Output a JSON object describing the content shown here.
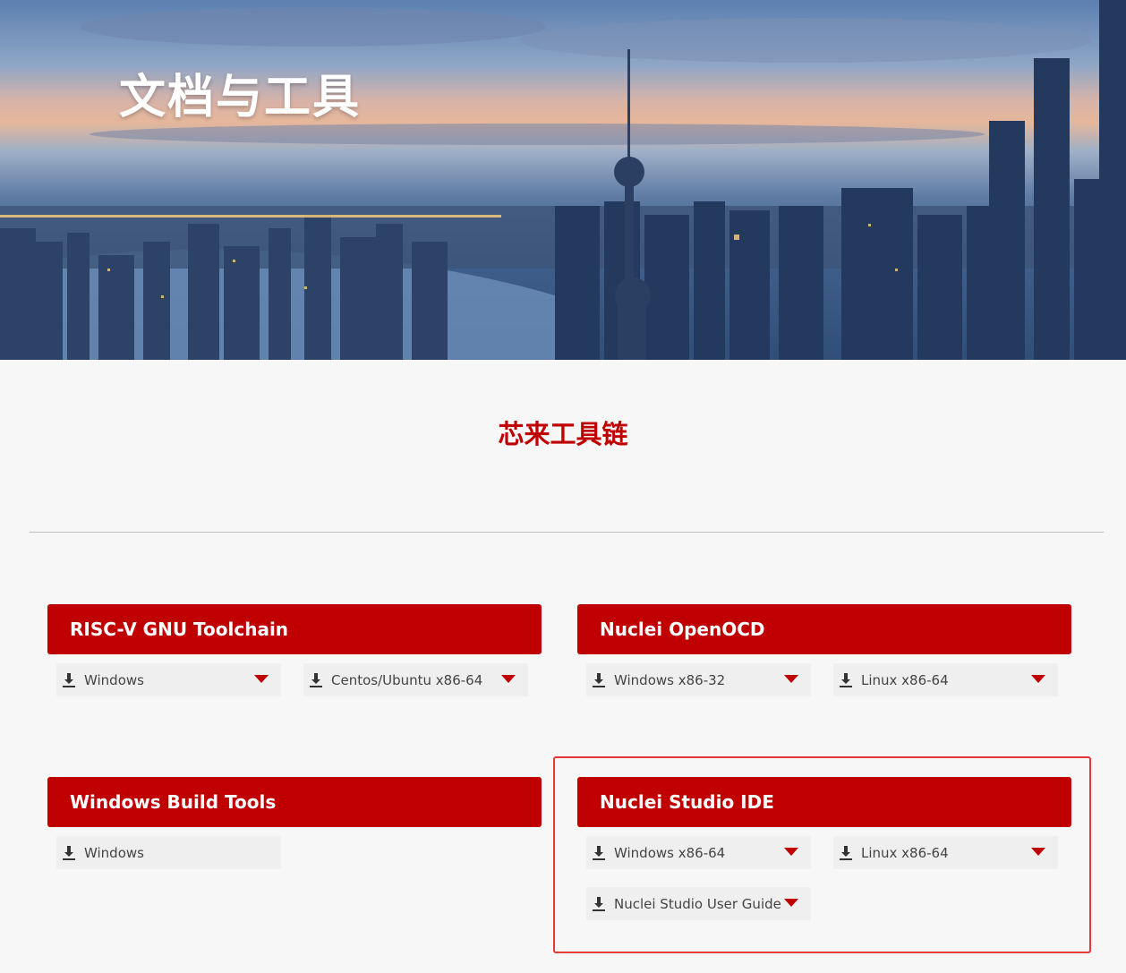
{
  "hero": {
    "title": "文档与工具"
  },
  "section": {
    "title": "芯来工具链"
  },
  "cards": [
    {
      "title": "RISC-V GNU Toolchain",
      "downloads": [
        {
          "label": "Windows"
        },
        {
          "label": "Centos/Ubuntu x86-64"
        }
      ]
    },
    {
      "title": "Nuclei OpenOCD",
      "downloads": [
        {
          "label": "Windows x86-32"
        },
        {
          "label": "Linux x86-64"
        }
      ]
    },
    {
      "title": "Windows Build Tools",
      "downloads": [
        {
          "label": "Windows"
        }
      ]
    },
    {
      "title": "Nuclei Studio IDE",
      "downloads": [
        {
          "label": "Windows x86-64"
        },
        {
          "label": "Linux x86-64"
        },
        {
          "label": "Nuclei Studio User Guide"
        }
      ]
    }
  ],
  "colors": {
    "accent": "#c00000",
    "highlight": "#e53935",
    "button_bg": "#efefef"
  },
  "icons": {
    "download": "download-icon",
    "dropdown": "caret-down-icon"
  }
}
